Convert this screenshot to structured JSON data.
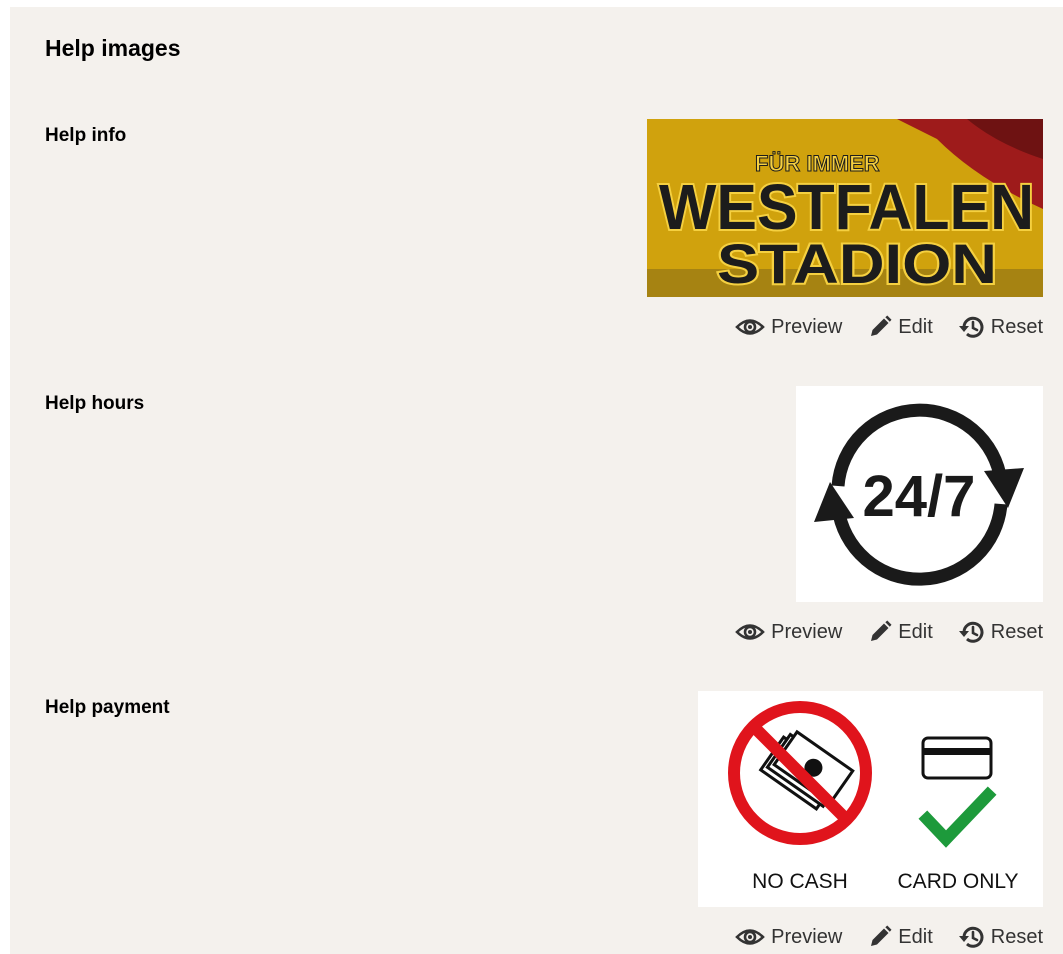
{
  "panel": {
    "title": "Help images"
  },
  "rows": [
    {
      "label": "Help info",
      "image": {
        "kind": "banner",
        "top_text": "FÜR IMMER",
        "line1": "WESTFALEN",
        "line2": "STADION",
        "bg_color": "#d6a90f",
        "ink_color": "#1c1c1c",
        "accent_color": "#9e1b1b"
      },
      "actions": {
        "preview": "Preview",
        "edit": "Edit",
        "reset": "Reset"
      }
    },
    {
      "label": "Help hours",
      "image": {
        "kind": "hours",
        "text": "24/7",
        "ink_color": "#1a1a1a"
      },
      "actions": {
        "preview": "Preview",
        "edit": "Edit",
        "reset": "Reset"
      }
    },
    {
      "label": "Help payment",
      "image": {
        "kind": "payment",
        "left_caption": "NO CASH",
        "right_caption": "CARD ONLY",
        "prohibit_color": "#e0141c",
        "check_color": "#1d9a3b"
      },
      "actions": {
        "preview": "Preview",
        "edit": "Edit",
        "reset": "Reset"
      }
    }
  ],
  "icons": {
    "preview": "eye-icon",
    "edit": "pencil-icon",
    "reset": "history-icon"
  }
}
